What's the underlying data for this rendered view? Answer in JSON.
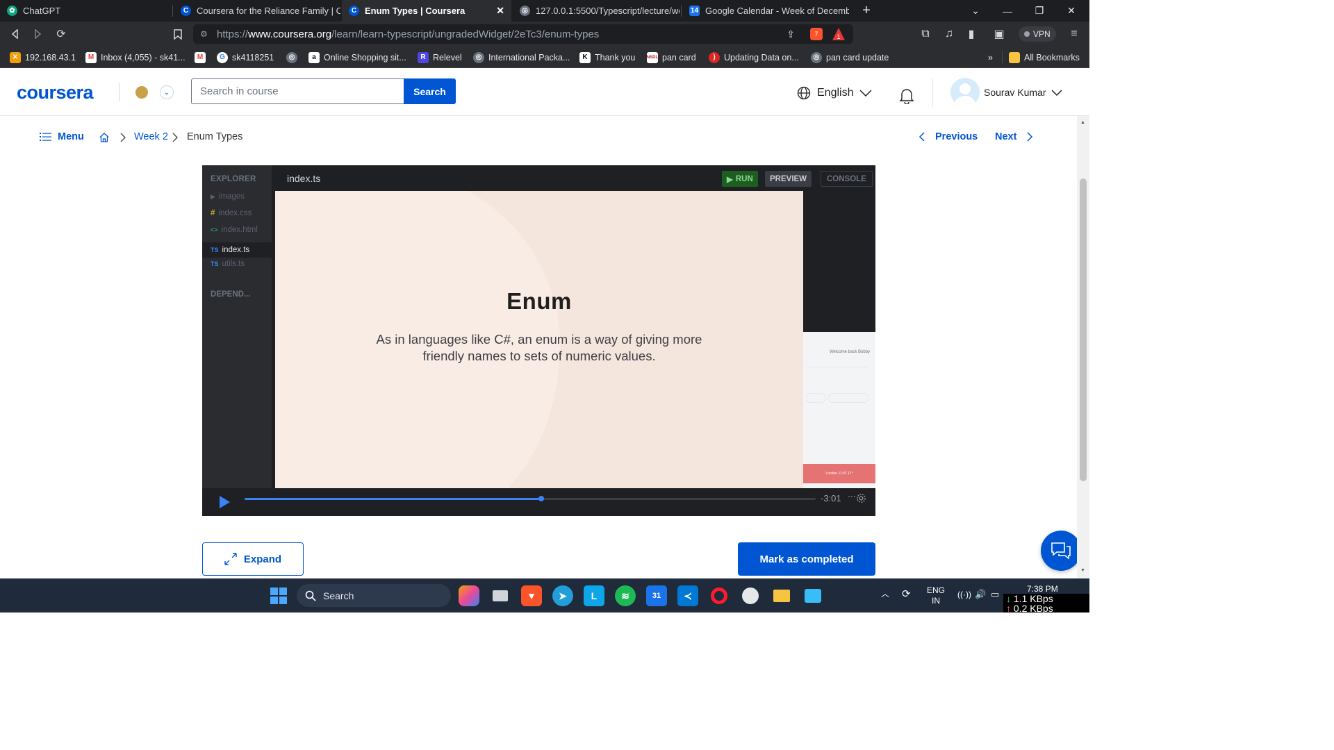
{
  "browser": {
    "tabs": [
      {
        "title": "ChatGPT",
        "active": false
      },
      {
        "title": "Coursera for the Reliance Family | Cou",
        "active": false
      },
      {
        "title": "Enum Types | Coursera",
        "active": true
      },
      {
        "title": "127.0.0.1:5500/Typescript/lecture/wee",
        "active": false
      },
      {
        "title": "Google Calendar - Week of December",
        "active": false
      }
    ],
    "url_scheme": "https://",
    "url_host": "www.coursera.org",
    "url_path": "/learn/learn-typescript/ungradedWidget/2eTc3/enum-types",
    "brave_badge": "7",
    "alert_badge": "1",
    "vpn_label": "VPN",
    "bookmarks": [
      "192.168.43.1",
      "Inbox (4,055) - sk41...",
      "sk4118251",
      "Online Shopping sit...",
      "Relevel",
      "International Packa...",
      "Thank you",
      "pan card",
      "Updating Data on...",
      "pan card update"
    ],
    "all_bookmarks": "All Bookmarks",
    "more_bookmarks": "»"
  },
  "header": {
    "logo": "coursera",
    "search_placeholder": "Search in course",
    "search_button": "Search",
    "language": "English",
    "user_name": "Sourav Kumar"
  },
  "breadcrumb": {
    "menu": "Menu",
    "week": "Week 2",
    "current": "Enum Types",
    "previous": "Previous",
    "next": "Next"
  },
  "editor": {
    "explorer_title": "EXPLORER",
    "files": [
      {
        "name": "images",
        "icon": "▶",
        "active": false
      },
      {
        "name": "index.css",
        "icon": "#",
        "active": false
      },
      {
        "name": "index.html",
        "icon": "<>",
        "active": false
      },
      {
        "name": "index.ts",
        "icon": "TS",
        "active": true
      },
      {
        "name": "utils.ts",
        "icon": "TS",
        "active": false
      }
    ],
    "dependencies": "DEPEND...",
    "open_file": "index.ts",
    "run_label": "RUN",
    "preview_label": "PREVIEW",
    "console_label": "CONSOLE",
    "preview_welcome": "Welcome back Bobby",
    "preview_footer": "London 11:01 17°"
  },
  "slide": {
    "title": "Enum",
    "body_line1": "As in languages like C#, an enum is a way of giving more",
    "body_line2": "friendly names to sets of numeric values."
  },
  "video": {
    "time_remaining": "-3:01",
    "progress": 0.52
  },
  "actions": {
    "expand": "Expand",
    "mark_completed": "Mark as completed"
  },
  "taskbar": {
    "search": "Search",
    "lang_line1": "ENG",
    "lang_line2": "IN",
    "time": "7:38 PM",
    "net_speed": "1.1 KBps",
    "net_speed2": "0.2 KBps"
  },
  "colors": {
    "brand": "#0056d2",
    "run_green": "#2e7d32",
    "slide_bg": "#f5e6dd"
  }
}
